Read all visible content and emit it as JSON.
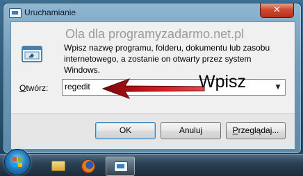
{
  "window": {
    "title": "Uruchamianie",
    "close_glyph": "✕"
  },
  "watermark": "Ola dla programyzadarmo.net.pl",
  "description": "Wpisz nazwę programu, folderu, dokumentu lub zasobu internetowego, a zostanie on otwarty przez system Windows.",
  "open": {
    "label_accel": "O",
    "label_rest": "twórz:",
    "value": "regedit"
  },
  "annotation": "Wpisz",
  "buttons": {
    "ok": "OK",
    "cancel": "Anuluj",
    "browse_accel": "P",
    "browse_rest": "rzeglądaj..."
  },
  "icons": {
    "title": "run-icon",
    "dialog": "run-program-icon",
    "taskbar": [
      "windows-start-icon",
      "folder-icon",
      "firefox-icon",
      "run-icon"
    ]
  },
  "colors": {
    "arrow": "#c0181c",
    "close_button": "#cf4a30"
  }
}
